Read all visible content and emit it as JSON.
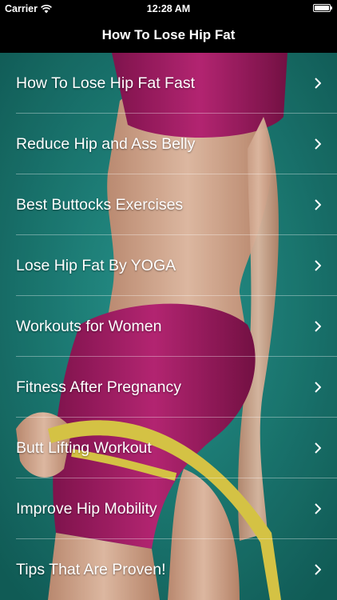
{
  "status_bar": {
    "carrier": "Carrier",
    "time": "12:28 AM"
  },
  "nav": {
    "title": "How To Lose Hip Fat"
  },
  "menu": {
    "items": [
      {
        "label": "How To Lose Hip Fat Fast"
      },
      {
        "label": "Reduce Hip and Ass Belly"
      },
      {
        "label": "Best Buttocks Exercises"
      },
      {
        "label": "Lose Hip Fat By YOGA"
      },
      {
        "label": "Workouts for Women"
      },
      {
        "label": "Fitness After Pregnancy"
      },
      {
        "label": "Butt Lifting Workout"
      },
      {
        "label": "Improve Hip Mobility"
      },
      {
        "label": "Tips That Are Proven!"
      }
    ]
  },
  "colors": {
    "background": "#1f8a82",
    "garment": "#b0206e",
    "skin": "#e2b79c",
    "tape": "#e6d34a"
  }
}
